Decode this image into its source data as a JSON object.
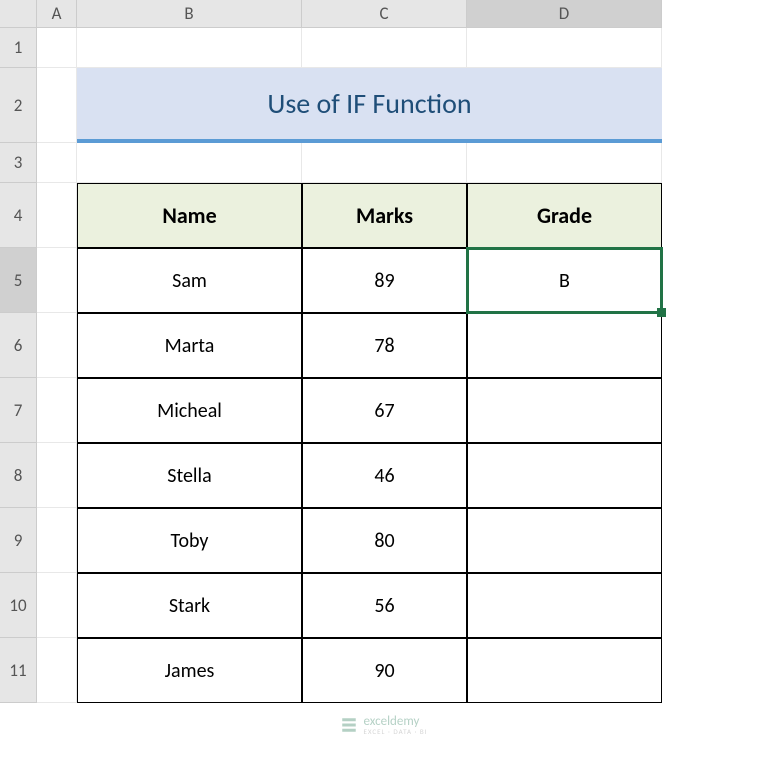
{
  "columns": [
    "A",
    "B",
    "C",
    "D"
  ],
  "rows": [
    "1",
    "2",
    "3",
    "4",
    "5",
    "6",
    "7",
    "8",
    "9",
    "10",
    "11"
  ],
  "title": "Use of IF Function",
  "table": {
    "headers": {
      "name": "Name",
      "marks": "Marks",
      "grade": "Grade"
    },
    "rows": [
      {
        "name": "Sam",
        "marks": "89",
        "grade": "B"
      },
      {
        "name": "Marta",
        "marks": "78",
        "grade": ""
      },
      {
        "name": "Micheal",
        "marks": "67",
        "grade": ""
      },
      {
        "name": "Stella",
        "marks": "46",
        "grade": ""
      },
      {
        "name": "Toby",
        "marks": "80",
        "grade": ""
      },
      {
        "name": "Stark",
        "marks": "56",
        "grade": ""
      },
      {
        "name": "James",
        "marks": "90",
        "grade": ""
      }
    ]
  },
  "watermark": {
    "name": "exceldemy",
    "tagline": "EXCEL · DATA · BI"
  },
  "active_cell": "D5",
  "chart_data": {
    "type": "table",
    "title": "Use of IF Function",
    "columns": [
      "Name",
      "Marks",
      "Grade"
    ],
    "rows": [
      [
        "Sam",
        89,
        "B"
      ],
      [
        "Marta",
        78,
        ""
      ],
      [
        "Micheal",
        67,
        ""
      ],
      [
        "Stella",
        46,
        ""
      ],
      [
        "Toby",
        80,
        ""
      ],
      [
        "Stark",
        56,
        ""
      ],
      [
        "James",
        90,
        ""
      ]
    ]
  }
}
